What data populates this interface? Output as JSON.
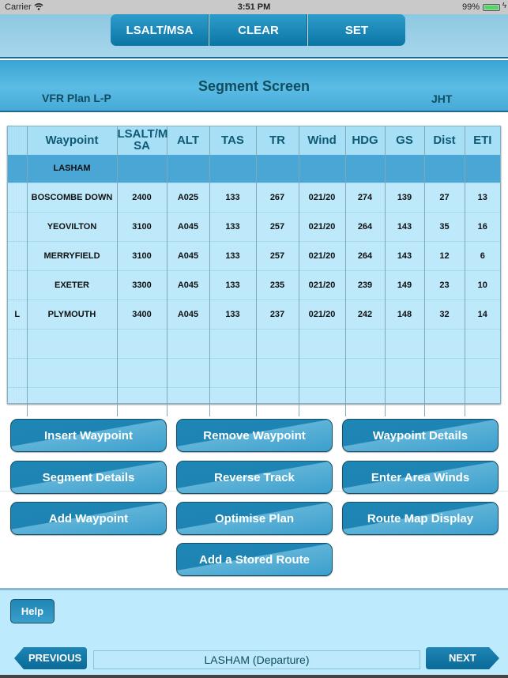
{
  "status_bar": {
    "carrier": "Carrier",
    "time": "3:51 PM",
    "battery_percent": "99%",
    "battery_level": 0.99
  },
  "toolbar": {
    "buttons": [
      "LSALT/MSA",
      "CLEAR",
      "SET"
    ]
  },
  "header": {
    "title": "Segment Screen",
    "plan_name": "VFR Plan L-P",
    "pilot_initials": "JHT"
  },
  "table": {
    "columns": [
      "",
      "Waypoint",
      "LSALT/M SA",
      "ALT",
      "TAS",
      "TR",
      "Wind",
      "HDG",
      "GS",
      "Dist",
      "ETI"
    ],
    "rows": [
      {
        "flag": "",
        "waypoint": "LASHAM",
        "lsalt": "",
        "alt": "",
        "tas": "",
        "tr": "",
        "wind": "",
        "hdg": "",
        "gs": "",
        "dist": "",
        "eti": "",
        "selected": true
      },
      {
        "flag": "",
        "waypoint": "BOSCOMBE DOWN",
        "lsalt": "2400",
        "alt": "A025",
        "tas": "133",
        "tr": "267",
        "wind": "021/20",
        "hdg": "274",
        "gs": "139",
        "dist": "27",
        "eti": "13"
      },
      {
        "flag": "",
        "waypoint": "YEOVILTON",
        "lsalt": "3100",
        "alt": "A045",
        "tas": "133",
        "tr": "257",
        "wind": "021/20",
        "hdg": "264",
        "gs": "143",
        "dist": "35",
        "eti": "16"
      },
      {
        "flag": "",
        "waypoint": "MERRYFIELD",
        "lsalt": "3100",
        "alt": "A045",
        "tas": "133",
        "tr": "257",
        "wind": "021/20",
        "hdg": "264",
        "gs": "143",
        "dist": "12",
        "eti": "6"
      },
      {
        "flag": "",
        "waypoint": "EXETER",
        "lsalt": "3300",
        "alt": "A045",
        "tas": "133",
        "tr": "235",
        "wind": "021/20",
        "hdg": "239",
        "gs": "149",
        "dist": "23",
        "eti": "10"
      },
      {
        "flag": "L",
        "waypoint": "PLYMOUTH",
        "lsalt": "3400",
        "alt": "A045",
        "tas": "133",
        "tr": "237",
        "wind": "021/20",
        "hdg": "242",
        "gs": "148",
        "dist": "32",
        "eti": "14"
      },
      {
        "flag": "",
        "waypoint": "",
        "lsalt": "",
        "alt": "",
        "tas": "",
        "tr": "",
        "wind": "",
        "hdg": "",
        "gs": "",
        "dist": "",
        "eti": ""
      },
      {
        "flag": "",
        "waypoint": "",
        "lsalt": "",
        "alt": "",
        "tas": "",
        "tr": "",
        "wind": "",
        "hdg": "",
        "gs": "",
        "dist": "",
        "eti": ""
      },
      {
        "flag": "",
        "waypoint": "",
        "lsalt": "",
        "alt": "",
        "tas": "",
        "tr": "",
        "wind": "",
        "hdg": "",
        "gs": "",
        "dist": "",
        "eti": ""
      }
    ]
  },
  "actions": {
    "insert_waypoint": "Insert Waypoint",
    "remove_waypoint": "Remove Waypoint",
    "waypoint_details": "Waypoint Details",
    "segment_details": "Segment Details",
    "reverse_track": "Reverse Track",
    "enter_area_winds": "Enter Area Winds",
    "add_waypoint": "Add Waypoint",
    "optimise_plan": "Optimise Plan",
    "route_map_display": "Route Map Display",
    "add_stored_route": "Add a Stored Route"
  },
  "footer": {
    "help": "Help",
    "previous": "PREVIOUS",
    "next": "NEXT",
    "current_location": "LASHAM (Departure)"
  },
  "colors": {
    "accent": "#1d84b3",
    "header_text": "#0f4d5e",
    "grid_bg": "#bde9fb",
    "selected_row": "#4aa7d5"
  }
}
